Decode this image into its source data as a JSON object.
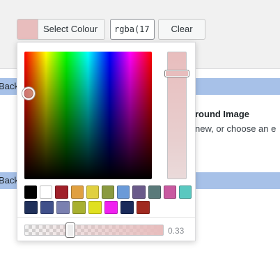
{
  "toolbar": {
    "swatch_color": "#e8bdbd",
    "select_label": "Select Colour",
    "value_text": "rgba(17",
    "clear_label": "Clear"
  },
  "background": {
    "row1_text": "Back",
    "row2_text": "Back",
    "section_title": "round Image",
    "section_desc": " new, or choose an e",
    "highlight_color": "#a7c1e8"
  },
  "picker": {
    "current_color": "#e8bdbd",
    "alpha": 0.33,
    "alpha_label": "0.33",
    "palette_row1": [
      "#000000",
      "#ffffff",
      "#a0202a",
      "#e0a040",
      "#e0d040",
      "#8a9a40",
      "#6a9ad8",
      "#6a5a8a",
      "#5a7a7a",
      "#c85aa0",
      "#5ac8c0"
    ],
    "palette_row2": [
      "#20305a",
      "#40508a",
      "#7a80b0",
      "#a8b030",
      "#e0e020",
      "#f020f0",
      "#1a2a5a",
      "#a02a20"
    ]
  }
}
